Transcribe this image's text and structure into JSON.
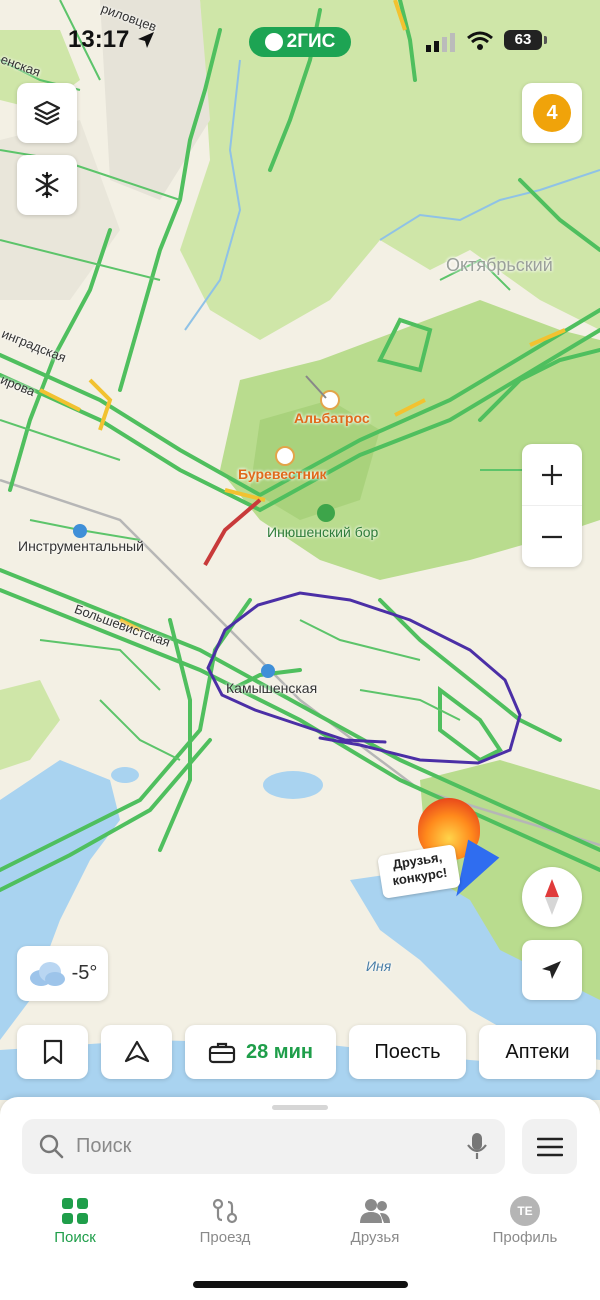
{
  "status_bar": {
    "time": "13:17",
    "brand": "2ГИС",
    "battery": "63"
  },
  "map": {
    "labels": {
      "oktyabrsky": "Октябрьский",
      "albatros": "Альбатрос",
      "burevestnik": "Буревестник",
      "inyushensky_bor": "Инюшенский бор",
      "instrumentalny": "Инструментальный",
      "kamyshenskaya": "Камышенская",
      "bolshevistskaya": "Большевистская",
      "leningradskaya": "инградская",
      "kirova": "ирова",
      "sennaya": "енская",
      "cherkovtseva": "риловцев",
      "inya": "Иня"
    },
    "promo": {
      "line1": "Друзья,",
      "line2": "конкурс!"
    }
  },
  "controls": {
    "notifications_count": "4",
    "weather_temp": "-5°",
    "layers_icon": "layers-icon",
    "snow_icon": "snowflake-icon"
  },
  "chips": {
    "commute_time": "28 мин",
    "eat": "Поесть",
    "pharmacies": "Аптеки"
  },
  "search": {
    "placeholder": "Поиск"
  },
  "tabs": [
    {
      "label": "Поиск",
      "active": true
    },
    {
      "label": "Проезд",
      "active": false
    },
    {
      "label": "Друзья",
      "active": false
    },
    {
      "label": "Профиль",
      "active": false,
      "avatar": "TE"
    }
  ],
  "colors": {
    "accent_green": "#1f9e4a",
    "brand_green": "#1da453",
    "badge_orange": "#f0a30a",
    "route_purple": "#4b2fa6"
  }
}
